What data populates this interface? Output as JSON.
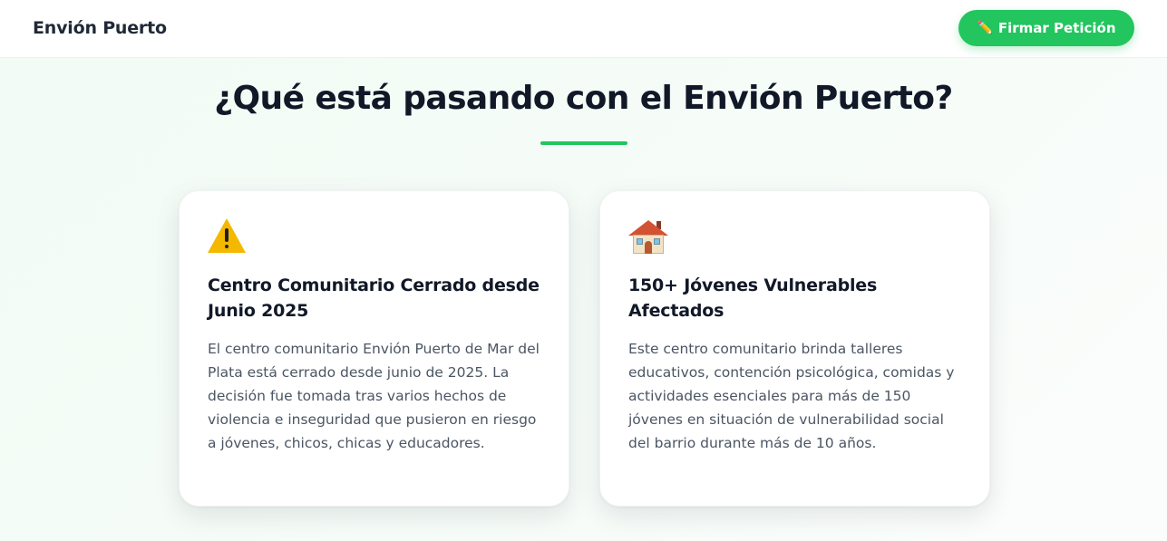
{
  "nav": {
    "brand": "Envión Puerto",
    "cta_icon": "✏️",
    "cta_label": "Firmar Petición"
  },
  "section": {
    "title": "¿Qué está pasando con el Envión Puerto?",
    "accent_color": "#22c55e"
  },
  "cards": [
    {
      "icon": "warning-icon",
      "heading": "Centro Comunitario Cerrado desde Junio 2025",
      "body": "El centro comunitario Envión Puerto de Mar del Plata está cerrado desde junio de 2025. La decisión fue tomada tras varios hechos de violencia e inseguridad que pusieron en riesgo a jóvenes, chicos, chicas y educadores."
    },
    {
      "icon": "house-icon",
      "heading": "150+ Jóvenes Vulnerables Afectados",
      "body": "Este centro comunitario brinda talleres educativos, contención psicológica, comidas y actividades esenciales para más de 150 jóvenes en situación de vulnerabilidad social del barrio durante más de 10 años."
    }
  ]
}
